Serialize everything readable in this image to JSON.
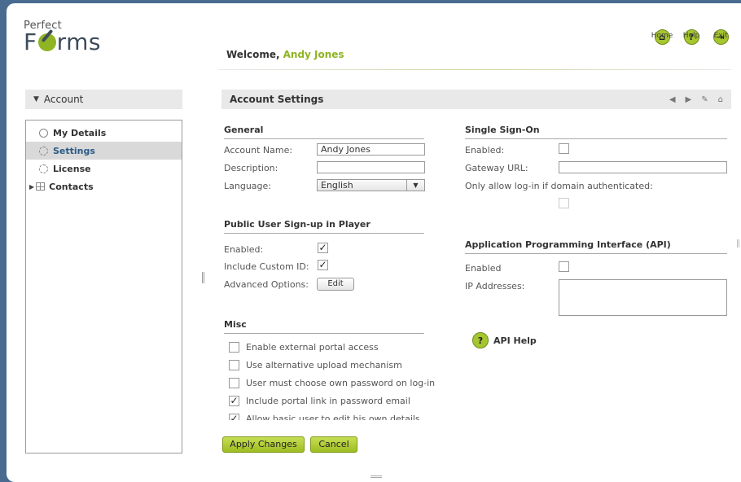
{
  "header": {
    "logo_small": "Perfect",
    "logo_big_pre": "F",
    "logo_big_post": "rms",
    "welcome_label": "Welcome,",
    "user_name": "Andy Jones",
    "icons": [
      {
        "name": "home-icon",
        "glyph": "⌂",
        "label": "Home"
      },
      {
        "name": "help-icon",
        "glyph": "?",
        "label": "Help"
      },
      {
        "name": "exit-icon",
        "glyph": "⇥",
        "label": "Exit"
      }
    ]
  },
  "sidebar": {
    "title": "Account",
    "items": [
      {
        "label": "My Details"
      },
      {
        "label": "Settings"
      },
      {
        "label": "License"
      },
      {
        "label": "Contacts"
      }
    ]
  },
  "main": {
    "title": "Account Settings",
    "tools": [
      "◀",
      "▶",
      "✎",
      "⌂"
    ],
    "general": {
      "title": "General",
      "account_name_label": "Account Name:",
      "account_name_value": "Andy Jones",
      "description_label": "Description:",
      "description_value": "",
      "language_label": "Language:",
      "language_value": "English"
    },
    "signup": {
      "title": "Public User Sign-up in Player",
      "enabled_label": "Enabled:",
      "enabled": true,
      "custom_id_label": "Include Custom ID:",
      "custom_id": true,
      "advanced_label": "Advanced Options:",
      "edit_label": "Edit"
    },
    "misc": {
      "title": "Misc",
      "items": [
        {
          "label": "Enable external portal access",
          "checked": false
        },
        {
          "label": "Use alternative upload mechanism",
          "checked": false
        },
        {
          "label": "User must choose own password on log-in",
          "checked": false
        },
        {
          "label": "Include portal link in password email",
          "checked": true
        },
        {
          "label": "Allow basic user to edit his own details",
          "checked": true
        }
      ]
    },
    "sso": {
      "title": "Single Sign-On",
      "enabled_label": "Enabled:",
      "enabled": false,
      "gateway_label": "Gateway URL:",
      "gateway_value": "",
      "domain_label": "Only allow log-in if domain authenticated:",
      "domain_checked": false
    },
    "api": {
      "title": "Application Programming Interface (API)",
      "enabled_label": "Enabled",
      "enabled": false,
      "ip_label": "IP Addresses:",
      "help_label": "API Help"
    },
    "buttons": {
      "apply": "Apply Changes",
      "cancel": "Cancel"
    }
  },
  "colors": {
    "accent": "#a6c62f",
    "frame_bg": "#4a6b90",
    "selected_text": "#2b5a86"
  }
}
